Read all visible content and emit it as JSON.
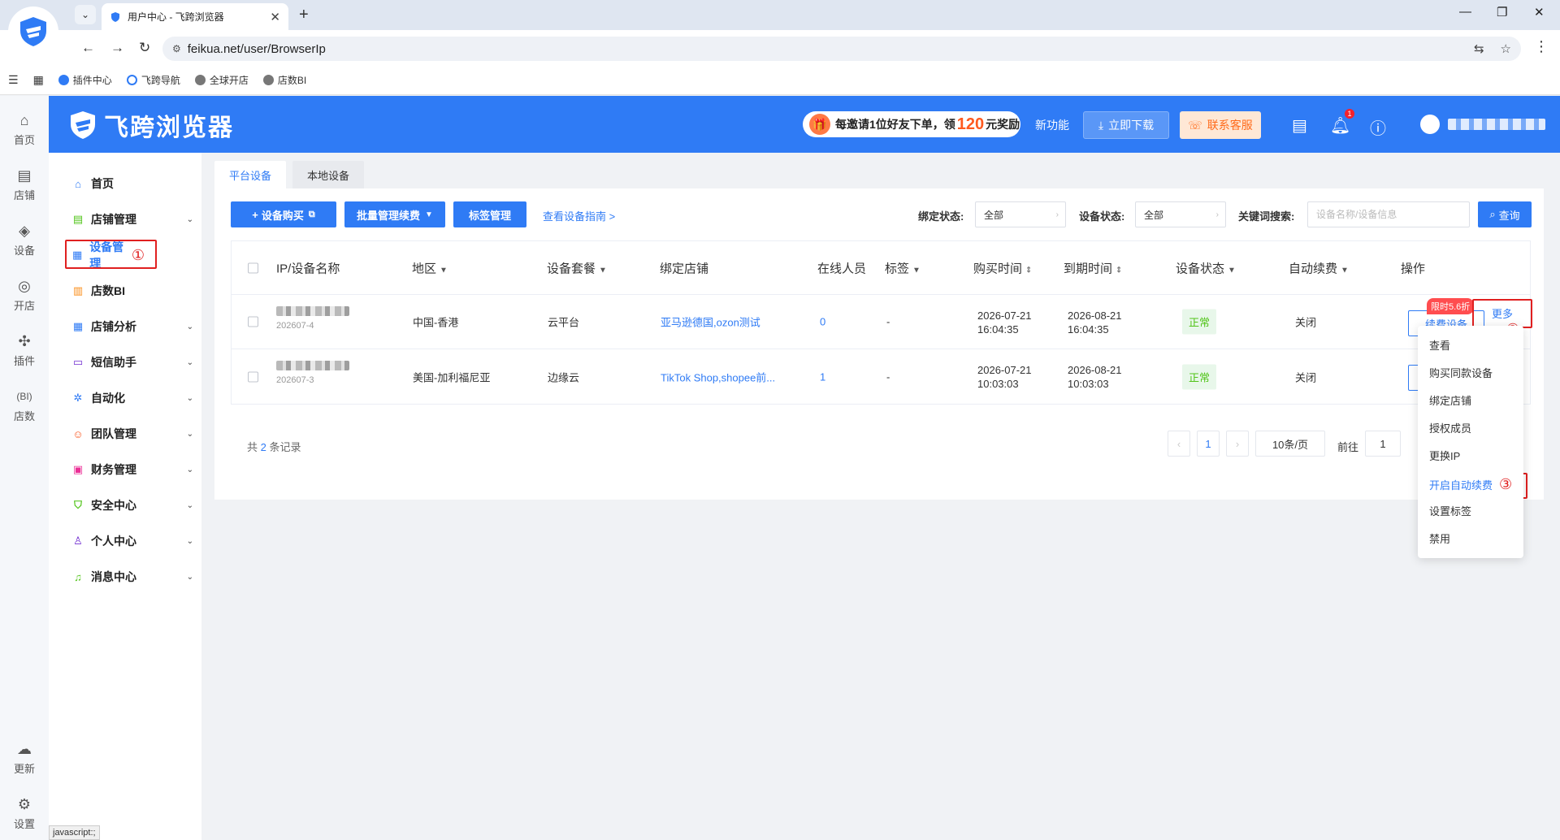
{
  "browser": {
    "tab_title": "用户中心 - 飞跨浏览器",
    "url": "feikua.net/user/BrowserIp",
    "bookmarks": [
      "插件中心",
      "飞跨导航",
      "全球开店",
      "店数BI"
    ]
  },
  "rail": {
    "items": [
      "首页",
      "店铺",
      "设备",
      "开店",
      "插件",
      "店数"
    ],
    "bottom": [
      "更新",
      "设置"
    ]
  },
  "header": {
    "brand": "飞跨浏览器",
    "invite_pre": "每邀请1位好友下单，领",
    "invite_num": "120",
    "invite_post": "元奖励",
    "new_feature": "新功能",
    "download": "立即下载",
    "service": "联系客服",
    "bell_count": "1"
  },
  "sidenav": {
    "items": [
      {
        "label": "首页",
        "icon": "home-icon"
      },
      {
        "label": "店铺管理",
        "icon": "shop-icon"
      },
      {
        "label": "设备管理",
        "icon": "device-icon"
      },
      {
        "label": "店数BI",
        "icon": "bi-icon"
      },
      {
        "label": "店铺分析",
        "icon": "analysis-icon"
      },
      {
        "label": "短信助手",
        "icon": "sms-icon"
      },
      {
        "label": "自动化",
        "icon": "automation-icon"
      },
      {
        "label": "团队管理",
        "icon": "team-icon"
      },
      {
        "label": "财务管理",
        "icon": "wallet-icon"
      },
      {
        "label": "安全中心",
        "icon": "shield-icon"
      },
      {
        "label": "个人中心",
        "icon": "user-icon"
      },
      {
        "label": "消息中心",
        "icon": "bell-icon"
      }
    ],
    "annotation_1": "①"
  },
  "status_hint": "javascript:;",
  "main": {
    "tabs": [
      "平台设备",
      "本地设备"
    ],
    "toolbar": {
      "buy": "设备购买",
      "batch": "批量管理续费",
      "tags": "标签管理",
      "guide": "查看设备指南 >"
    },
    "filters": {
      "bind_label": "绑定状态:",
      "bind_value": "全部",
      "status_label": "设备状态:",
      "status_value": "全部",
      "keyword_label": "关键词搜索:",
      "keyword_placeholder": "设备名称/设备信息",
      "query": "查询"
    },
    "columns": [
      "IP/设备名称",
      "地区",
      "设备套餐",
      "绑定店铺",
      "在线人员",
      "标签",
      "购买时间",
      "到期时间",
      "设备状态",
      "自动续费",
      "操作"
    ],
    "rows": [
      {
        "id": "202607-4",
        "region": "中国-香港",
        "plan": "云平台",
        "shop": "亚马逊德国,ozon测试",
        "online": "0",
        "tag": "-",
        "buy_date": "2026-07-21",
        "buy_time": "16:04:35",
        "exp_date": "2026-08-21",
        "exp_time": "16:04:35",
        "status": "正常",
        "auto": "关闭"
      },
      {
        "id": "202607-3",
        "region": "美国-加利福尼亚",
        "plan": "边缘云",
        "shop": "TikTok Shop,shopee前...",
        "online": "1",
        "tag": "-",
        "buy_date": "2026-07-21",
        "buy_time": "10:03:03",
        "exp_date": "2026-08-21",
        "exp_time": "10:03:03",
        "status": "正常",
        "auto": "关闭"
      }
    ],
    "renew_btn": "续费设备",
    "discount": "限时5.6折",
    "more": "更多",
    "annotation_2": "②",
    "total_pre": "共",
    "total_num": "2",
    "total_post": "条记录",
    "page": "1",
    "page_size": "10条/页",
    "goto": "前往",
    "goto_val": "1"
  },
  "dropdown": {
    "items": [
      "查看",
      "购买同款设备",
      "绑定店铺",
      "授权成员",
      "更换IP",
      "开启自动续费",
      "设置标签",
      "禁用"
    ],
    "annotation_3": "③"
  },
  "colors": {
    "brand": "#2f7bf5",
    "annotation": "#e02020",
    "ok": "#52c41a",
    "accent": "#ff6a1a"
  }
}
